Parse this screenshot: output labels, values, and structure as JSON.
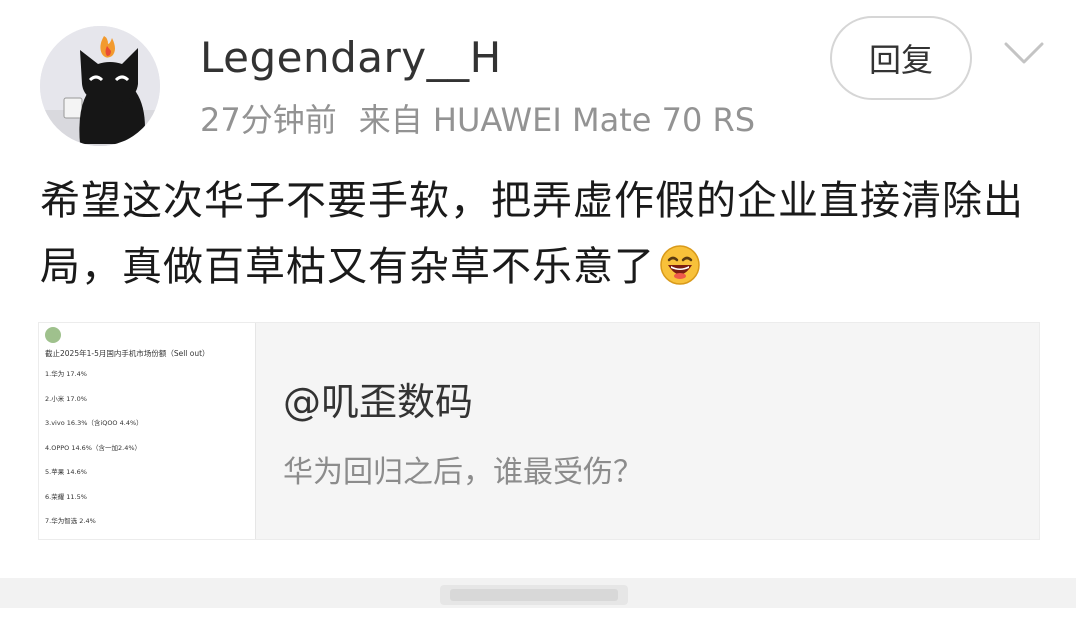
{
  "post": {
    "username": "Legendary__H",
    "time": "27分钟前",
    "source": "来自 HUAWEI Mate 70 RS",
    "reply_label": "回复",
    "text": "希望这次华子不要手软，把弄虚作假的企业直接清除出局，真做百草枯又有杂草不乐意了",
    "emoji_icon": "laughing-emoji-icon"
  },
  "quote": {
    "author": "@叽歪数码",
    "description": "华为回归之后，谁最受伤？",
    "thumbnail": {
      "heading": "截止2025年1-5月国内手机市场份额（Sell out）",
      "items": [
        "1.华为 17.4%",
        "2.小米 17.0%",
        "3.vivo 16.3%（含iQOO 4.4%）",
        "4.OPPO 14.6%（含一加2.4%）",
        "5.苹果 14.6%",
        "6.荣耀 11.5%",
        "7.华为智选 2.4%"
      ]
    }
  },
  "colors": {
    "text_primary": "#1a1a1a",
    "text_secondary": "#939393",
    "card_bg": "#f5f5f5"
  }
}
